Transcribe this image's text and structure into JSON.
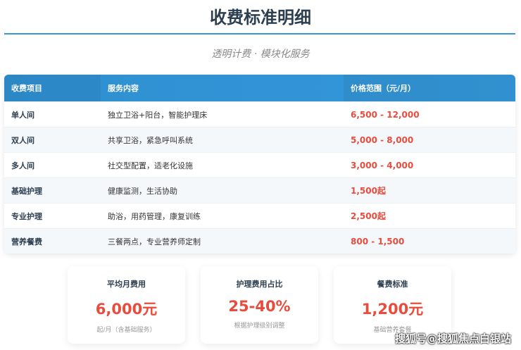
{
  "title": "收费标准明细",
  "subtitle": "透明计费 · 模块化服务",
  "table": {
    "headers": [
      "收费项目",
      "服务内容",
      "价格范围（元/月）"
    ],
    "rows": [
      [
        "单人间",
        "独立卫浴+阳台，智能护理床",
        "6,500 - 12,000"
      ],
      [
        "双人间",
        "共享卫浴，紧急呼叫系统",
        "5,000 - 8,000"
      ],
      [
        "多人间",
        "社交型配置，适老化设施",
        "3,000 - 4,000"
      ],
      [
        "基础护理",
        "健康监测，生活协助",
        "1,500起"
      ],
      [
        "专业护理",
        "助浴，用药管理，康复训练",
        "2,500起"
      ],
      [
        "营养餐费",
        "三餐两点，专业营养师定制",
        "800 - 1,500"
      ]
    ]
  },
  "cards": [
    {
      "label": "平均月费用",
      "value": "6,000元",
      "note": "起/月（含基础服务）"
    },
    {
      "label": "护理费用占比",
      "value": "25-40%",
      "note": "根据护理级别调整"
    },
    {
      "label": "餐费标准",
      "value": "1,200元",
      "note": "基础营养套餐"
    }
  ],
  "watermark": "搜狐号@搜狐焦点白银站"
}
